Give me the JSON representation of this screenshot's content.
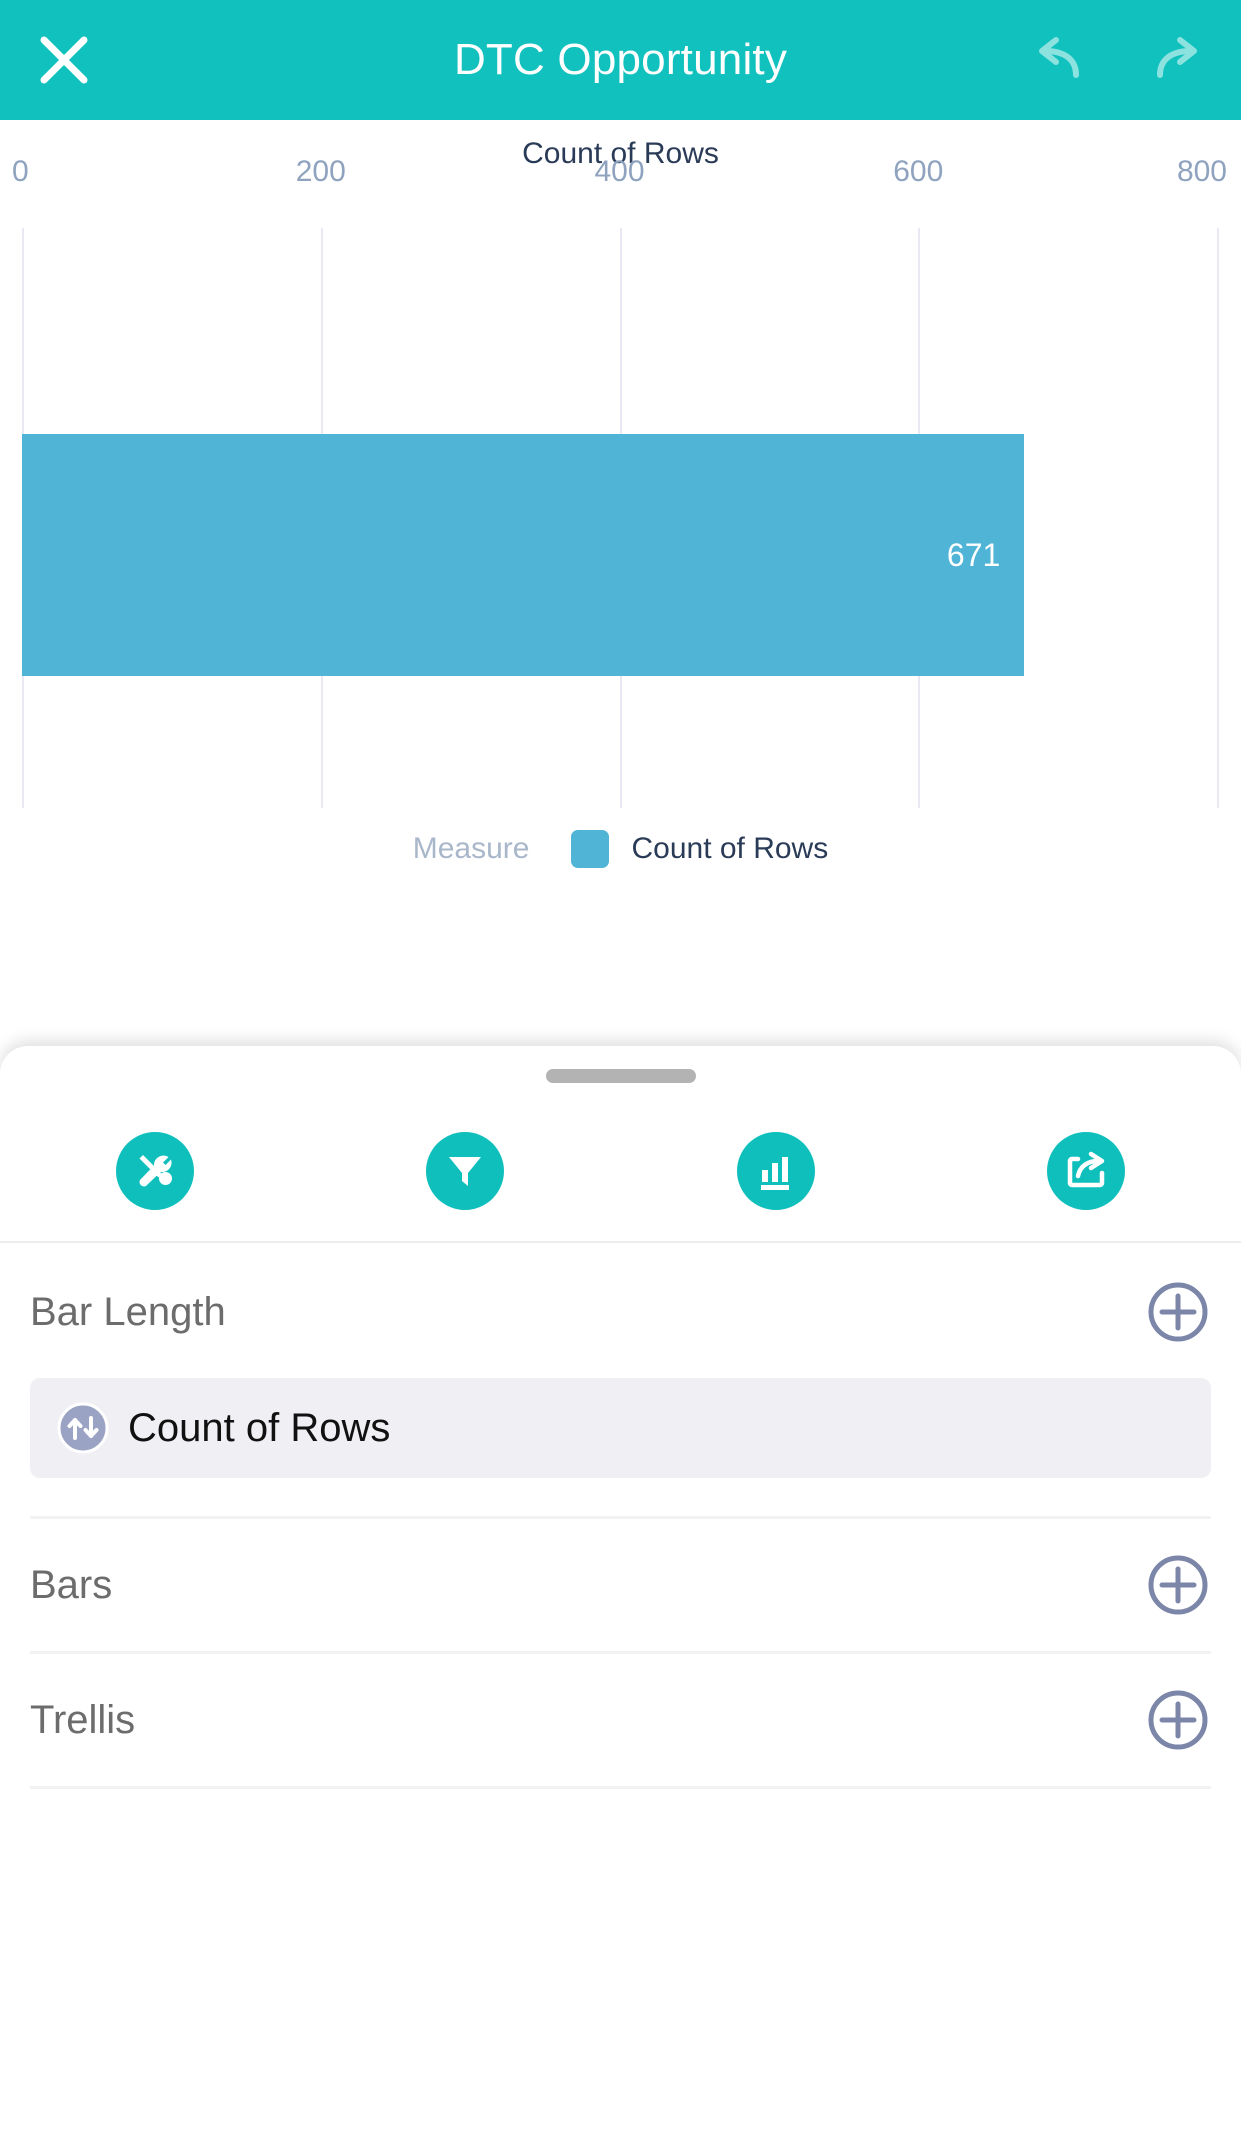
{
  "header": {
    "title": "DTC Opportunity",
    "close_icon": "close-x-icon",
    "undo_icon": "undo-arrow-icon",
    "redo_icon": "redo-arrow-icon",
    "background_color": "#11C1BE"
  },
  "chart_data": {
    "type": "bar",
    "orientation": "horizontal",
    "title": "Count of Rows",
    "xlabel": "",
    "ylabel": "",
    "categories": [
      "Count of Rows"
    ],
    "values": [
      671
    ],
    "value_labels": [
      "671"
    ],
    "xlim": [
      0,
      800
    ],
    "x_ticks": [
      0,
      200,
      400,
      600,
      800
    ],
    "x_tick_labels": [
      "0",
      "200",
      "400",
      "600",
      "800"
    ],
    "grid": true,
    "grid_axis": "x",
    "bar_color": "#4FB4D6",
    "legend": {
      "position": "bottom",
      "caption": "Measure",
      "entries": [
        {
          "label": "Count of Rows",
          "color": "#4FB4D6"
        }
      ]
    }
  },
  "sheet": {
    "grabber": "drag-handle",
    "toolbar": [
      {
        "name": "tools-button",
        "icon": "tools-wrench-screwdriver-icon",
        "color": "#0FBFBC"
      },
      {
        "name": "filter-button",
        "icon": "funnel-filter-icon",
        "color": "#0FBFBC"
      },
      {
        "name": "chart-type-button",
        "icon": "bar-chart-icon",
        "color": "#0FBFBC"
      },
      {
        "name": "share-button",
        "icon": "share-export-icon",
        "color": "#0FBFBC"
      }
    ],
    "shelves": [
      {
        "title": "Bar Length",
        "add_icon": "plus-circle-icon",
        "fields": [
          {
            "label": "Count of Rows",
            "icon": "measure-updown-arrows-icon"
          }
        ]
      },
      {
        "title": "Bars",
        "add_icon": "plus-circle-icon",
        "fields": []
      },
      {
        "title": "Trellis",
        "add_icon": "plus-circle-icon",
        "fields": []
      }
    ]
  },
  "colors": {
    "accent_teal": "#11C1BE",
    "bar_blue": "#4FB4D6",
    "text_navy": "#2A3B57",
    "tick_blue": "#8FA3BF",
    "icon_slate": "#7C86A8",
    "chip_bg": "#F0F0F4"
  }
}
